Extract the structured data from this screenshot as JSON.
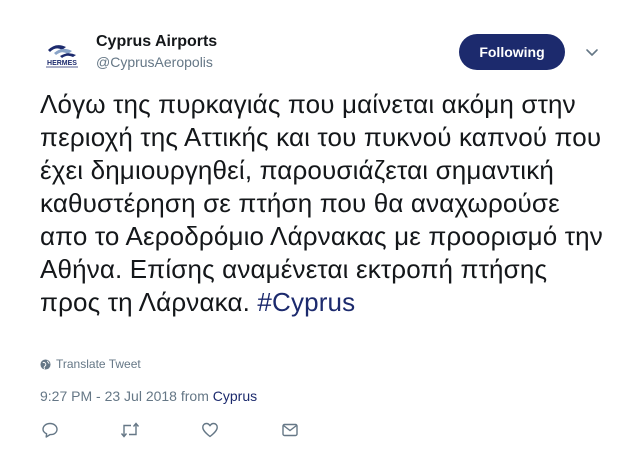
{
  "account": {
    "display_name": "Cyprus Airports",
    "handle": "@CyprusAeropolis",
    "avatar_text": "HERMES",
    "avatar_icon": "hermes-logo-icon"
  },
  "follow_button": {
    "label": "Following"
  },
  "tweet": {
    "text": "Λόγω της πυρκαγιάς που μαίνεται ακόμη στην περιοχή της Αττικής και του πυκνού καπνού που έχει δημιουργηθεί, παρουσιάζεται σημαντική καθυστέρηση σε πτήση που θα αναχωρούσε απο το Αεροδρόμιο Λάρνακας με προορισμό την Αθήνα. Επίσης αναμένεται εκτροπή πτήσης προς τη Λάρνακα. ",
    "hashtag": "#Cyprus"
  },
  "translate": {
    "label": "Translate Tweet",
    "icon": "globe-icon"
  },
  "meta": {
    "timestamp": "9:27 PM - 23 Jul 2018",
    "from_prefix": " from ",
    "location": "Cyprus"
  },
  "actions": [
    {
      "name": "reply",
      "icon": "reply-icon"
    },
    {
      "name": "retweet",
      "icon": "retweet-icon"
    },
    {
      "name": "like",
      "icon": "heart-icon"
    },
    {
      "name": "message",
      "icon": "envelope-icon"
    }
  ],
  "colors": {
    "accent": "#1c2a6d",
    "text": "#14171a",
    "muted": "#657786"
  }
}
